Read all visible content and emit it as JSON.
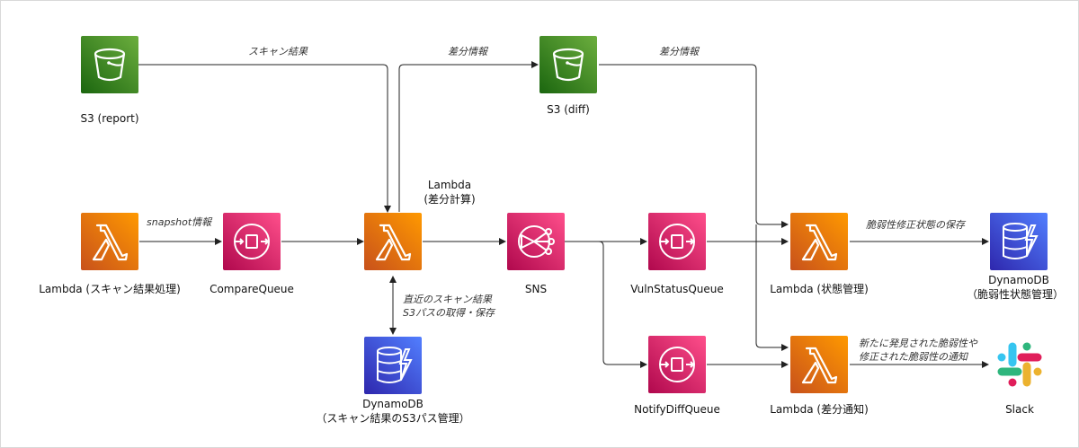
{
  "nodes": {
    "s3_report": "S3 (report)",
    "s3_diff": "S3 (diff)",
    "lambda_scan_line1": "Lambda (スキャン結果処理)",
    "compare_queue": "CompareQueue",
    "lambda_diff_line1": "Lambda",
    "lambda_diff_line2": "(差分計算)",
    "sns": "SNS",
    "dynamo_s3path_line1": "DynamoDB",
    "dynamo_s3path_line2": "（スキャン結果のS3パス管理）",
    "vuln_status_queue": "VulnStatusQueue",
    "notify_diff_queue": "NotifyDiffQueue",
    "lambda_status": "Lambda (状態管理)",
    "lambda_notify": "Lambda (差分通知)",
    "dynamo_vuln_line1": "DynamoDB",
    "dynamo_vuln_line2": "（脆弱性状態管理）",
    "slack": "Slack"
  },
  "edge_labels": {
    "scan_result": "スキャン結果",
    "diff_info_1": "差分情報",
    "diff_info_2": "差分情報",
    "snapshot_info": "snapshot情報",
    "recent_line1": "直近のスキャン結果",
    "recent_line2": "S3パスの取得・保存",
    "save_vuln": "脆弱性修正状態の保存",
    "notify_line1": "新たに発見された脆弱性や",
    "notify_line2": "修正された脆弱性の通知"
  },
  "icons": {
    "s3": "s3-bucket-icon",
    "lambda": "lambda-icon",
    "sqs": "sqs-queue-icon",
    "sns": "sns-topic-icon",
    "dynamodb": "dynamodb-icon",
    "slack": "slack-logo-icon"
  },
  "colors": {
    "s3": "#3f8624",
    "lambda": "#ed7100",
    "sqs": "#e7157b",
    "ddb": "#3b48cc",
    "edge": "#222222"
  }
}
